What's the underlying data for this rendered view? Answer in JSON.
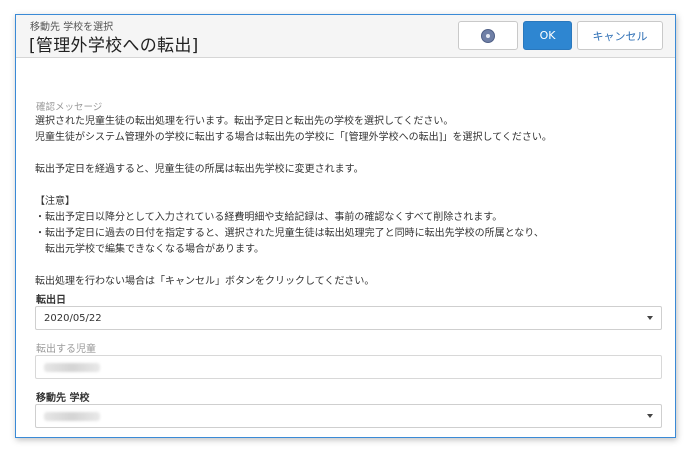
{
  "header": {
    "subtitle": "移動先 学校を選択",
    "title": "[管理外学校への転出]",
    "ok_label": "OK",
    "cancel_label": "キャンセル"
  },
  "message": {
    "caption": "確認メッセージ",
    "text": "選択された児童生徒の転出処理を行います。転出予定日と転出先の学校を選択してください。\n児童生徒がシステム管理外の学校に転出する場合は転出先の学校に「[管理外学校への転出]」を選択してください。\n\n転出予定日を経過すると、児童生徒の所属は転出先学校に変更されます。\n\n【注意】\n・転出予定日以降分として入力されている経費明細や支給記録は、事前の確認なくすべて削除されます。\n・転出予定日に過去の日付を指定すると、選択された児童生徒は転出処理完了と同時に転出先学校の所属となり、\n　転出元学校で編集できなくなる場合があります。\n\n転出処理を行わない場合は「キャンセル」ボタンをクリックしてください。"
  },
  "form": {
    "date_label": "転出日",
    "date_value": "2020/05/22",
    "student_label": "転出する児童",
    "school_label": "移動先 学校"
  },
  "colors": {
    "accent": "#2e86d1",
    "border": "#3a8ad6"
  },
  "icons": {
    "help": "help-icon",
    "dropdown": "chevron-down-icon"
  }
}
